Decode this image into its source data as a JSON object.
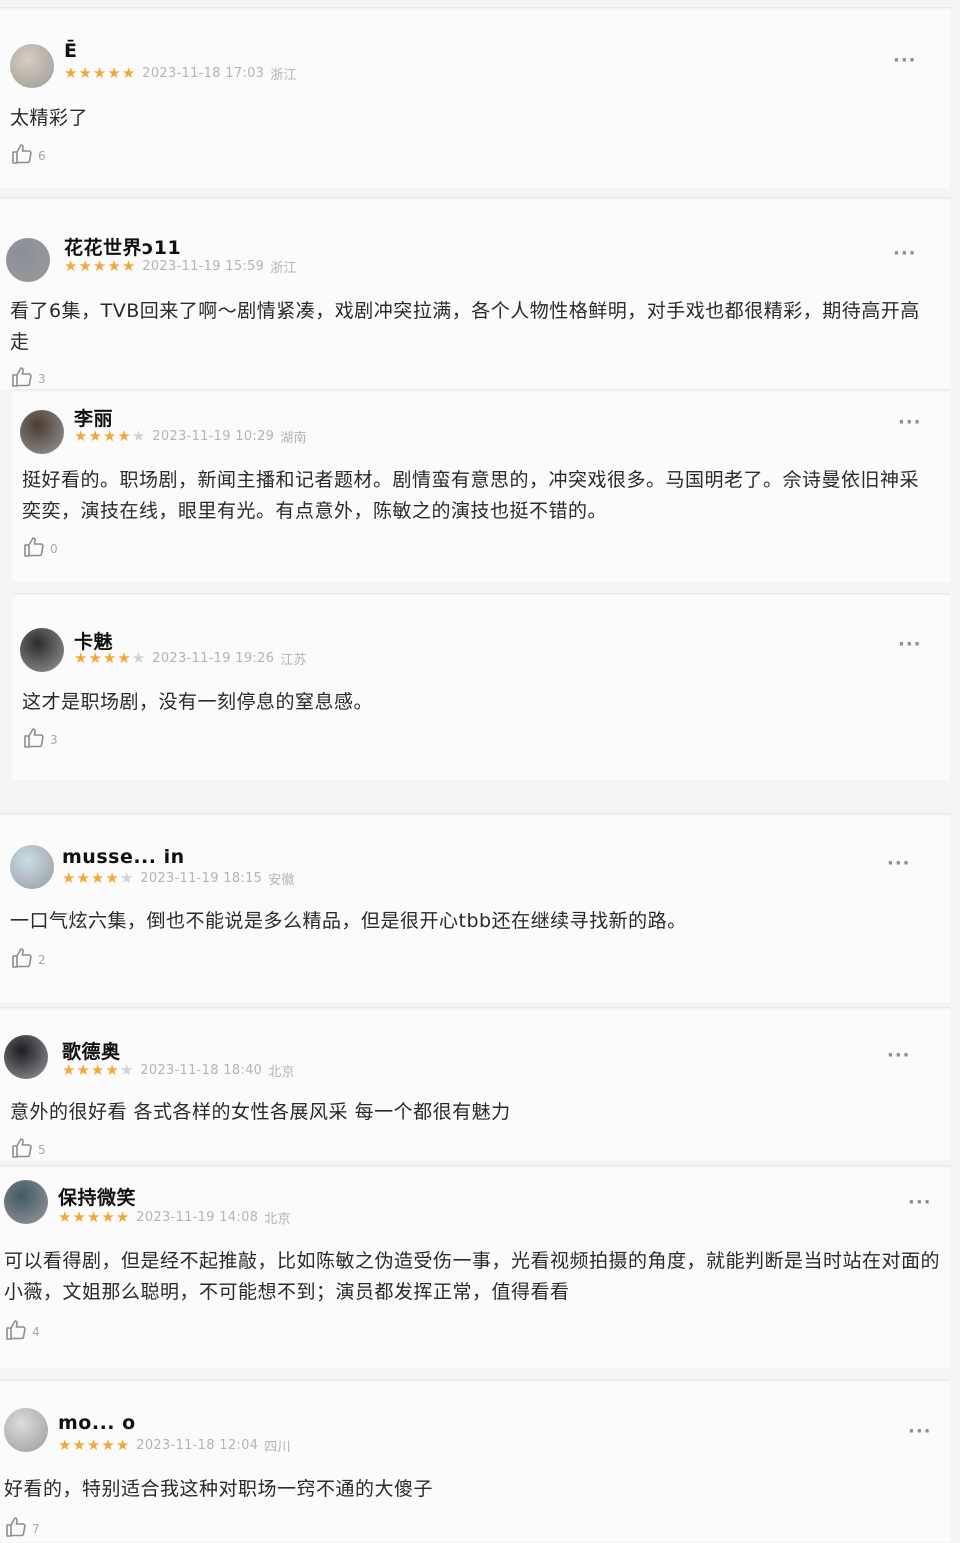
{
  "comments": [
    {
      "user": "Ē",
      "rating": 5,
      "date": "2023-11-18 17:03",
      "location": "浙江",
      "text": "太精彩了",
      "likes": "6",
      "avatar_color": "#d9cdbf"
    },
    {
      "user": "花花世界ɔ11",
      "rating": 5,
      "date": "2023-11-19 15:59",
      "location": "浙江",
      "text": "看了6集，TVB回来了啊～剧情紧凑，戏剧冲突拉满，各个人物性格鲜明，对手戏也都很精彩，期待高开高走",
      "likes": "3",
      "avatar_color": "#8a8f97"
    },
    {
      "user": "李丽",
      "rating": 4,
      "date": "2023-11-19 10:29",
      "location": "湖南",
      "text": "挺好看的。职场剧，新闻主播和记者题材。剧情蛮有意思的，冲突戏很多。马国明老了。佘诗曼依旧神采奕奕，演技在线，眼里有光。有点意外，陈敏之的演技也挺不错的。",
      "likes": "0",
      "avatar_color": "#4a3c33"
    },
    {
      "user": "卡魅",
      "rating": 4,
      "date": "2023-11-19 19:26",
      "location": "江苏",
      "text": "这才是职场剧，没有一刻停息的窒息感。",
      "likes": "3",
      "avatar_color": "#2c2c2e"
    },
    {
      "user": "musse... in",
      "rating": 4,
      "date": "2023-11-19 18:15",
      "location": "安徽",
      "text": "一口气炫六集，倒也不能说是多么精品，但是很开心tbb还在继续寻找新的路。",
      "likes": "2",
      "avatar_color": "#c9dde8"
    },
    {
      "user": "歌德奥",
      "rating": 4,
      "date": "2023-11-18 18:40",
      "location": "北京",
      "text": "意外的很好看 各式各样的女性各展风采 每一个都很有魅力",
      "likes": "5",
      "avatar_color": "#1e1a22"
    },
    {
      "user": "保持微笑",
      "rating": 5,
      "date": "2023-11-19 14:08",
      "location": "北京",
      "text": "可以看得剧，但是经不起推敲，比如陈敏之伪造受伤一事，光看视频拍摄的角度，就能判断是当时站在对面的小薇，文姐那么聪明，不可能想不到；演员都发挥正常，值得看看",
      "likes": "4",
      "avatar_color": "#3f5a63"
    },
    {
      "user": "mo... o",
      "rating": 5,
      "date": "2023-11-18 12:04",
      "location": "四川",
      "text": "好看的，特别适合我这种对职场一窍不通的大傻子",
      "likes": "7",
      "avatar_color": "#dcdcdc"
    }
  ],
  "more_label": "···",
  "icons": {
    "like": "thumbs-up-icon",
    "more": "more-icon",
    "star": "star-icon"
  }
}
